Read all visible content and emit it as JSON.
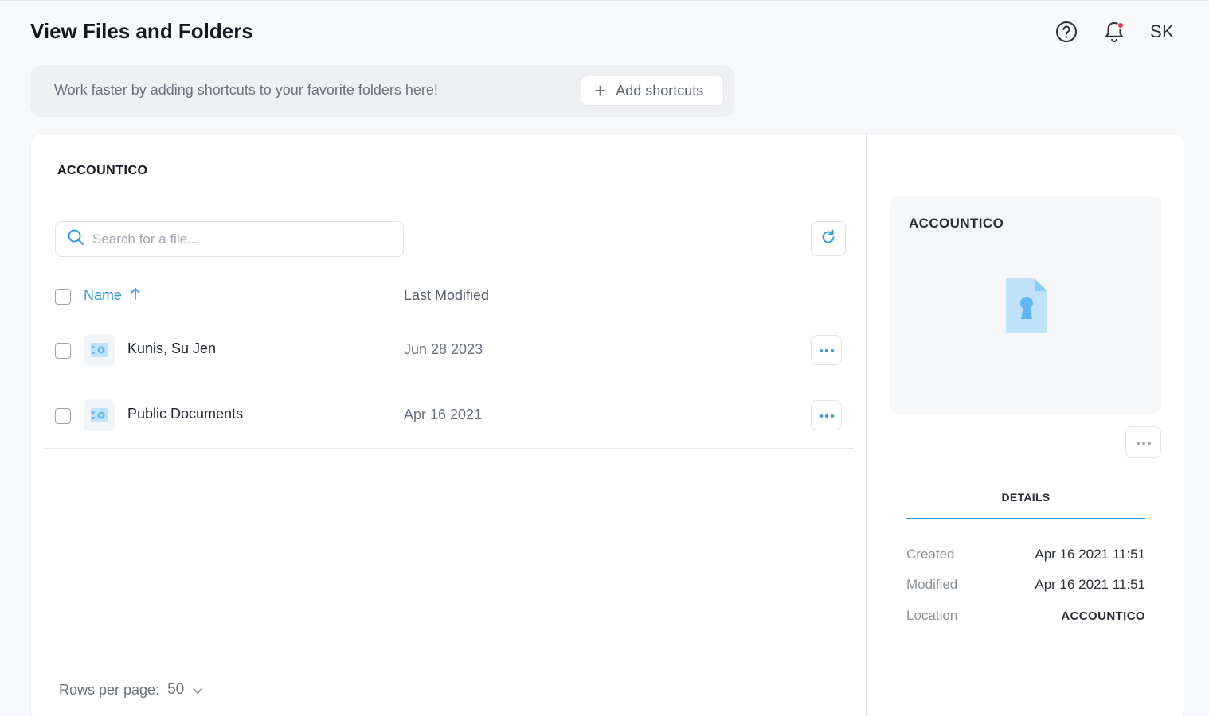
{
  "header": {
    "title": "View Files and Folders",
    "avatar_initials": "SK"
  },
  "shortcuts": {
    "message": "Work faster by adding shortcuts to your favorite folders here!",
    "button_label": "Add shortcuts"
  },
  "browser": {
    "folder_name": "ACCOUNTICO",
    "search_placeholder": "Search for a file...",
    "columns": {
      "name": "Name",
      "last_modified": "Last Modified"
    },
    "rows": [
      {
        "name": "Kunis, Su Jen",
        "modified": "Jun 28 2023"
      },
      {
        "name": "Public Documents",
        "modified": "Apr 16 2021"
      }
    ],
    "rows_per_page_label": "Rows per page:",
    "rows_per_page_value": "50"
  },
  "preview": {
    "title": "ACCOUNTICO",
    "details_tab": "DETAILS",
    "details": [
      {
        "key": "Created",
        "value": "Apr 16 2021 11:51"
      },
      {
        "key": "Modified",
        "value": "Apr 16 2021 11:51"
      },
      {
        "key": "Location",
        "value": "ACCOUNTICO"
      }
    ]
  },
  "colors": {
    "accent": "#2e9be8",
    "notification_dot": "#e2344b",
    "folder_icon": "#5fb6f0"
  },
  "icons": [
    "help-icon",
    "bell-icon",
    "plus-icon",
    "search-icon",
    "refresh-icon",
    "sort-arrow-up-icon",
    "shared-folder-icon",
    "more-dots-icon",
    "file-lock-icon",
    "chevron-down-icon"
  ]
}
